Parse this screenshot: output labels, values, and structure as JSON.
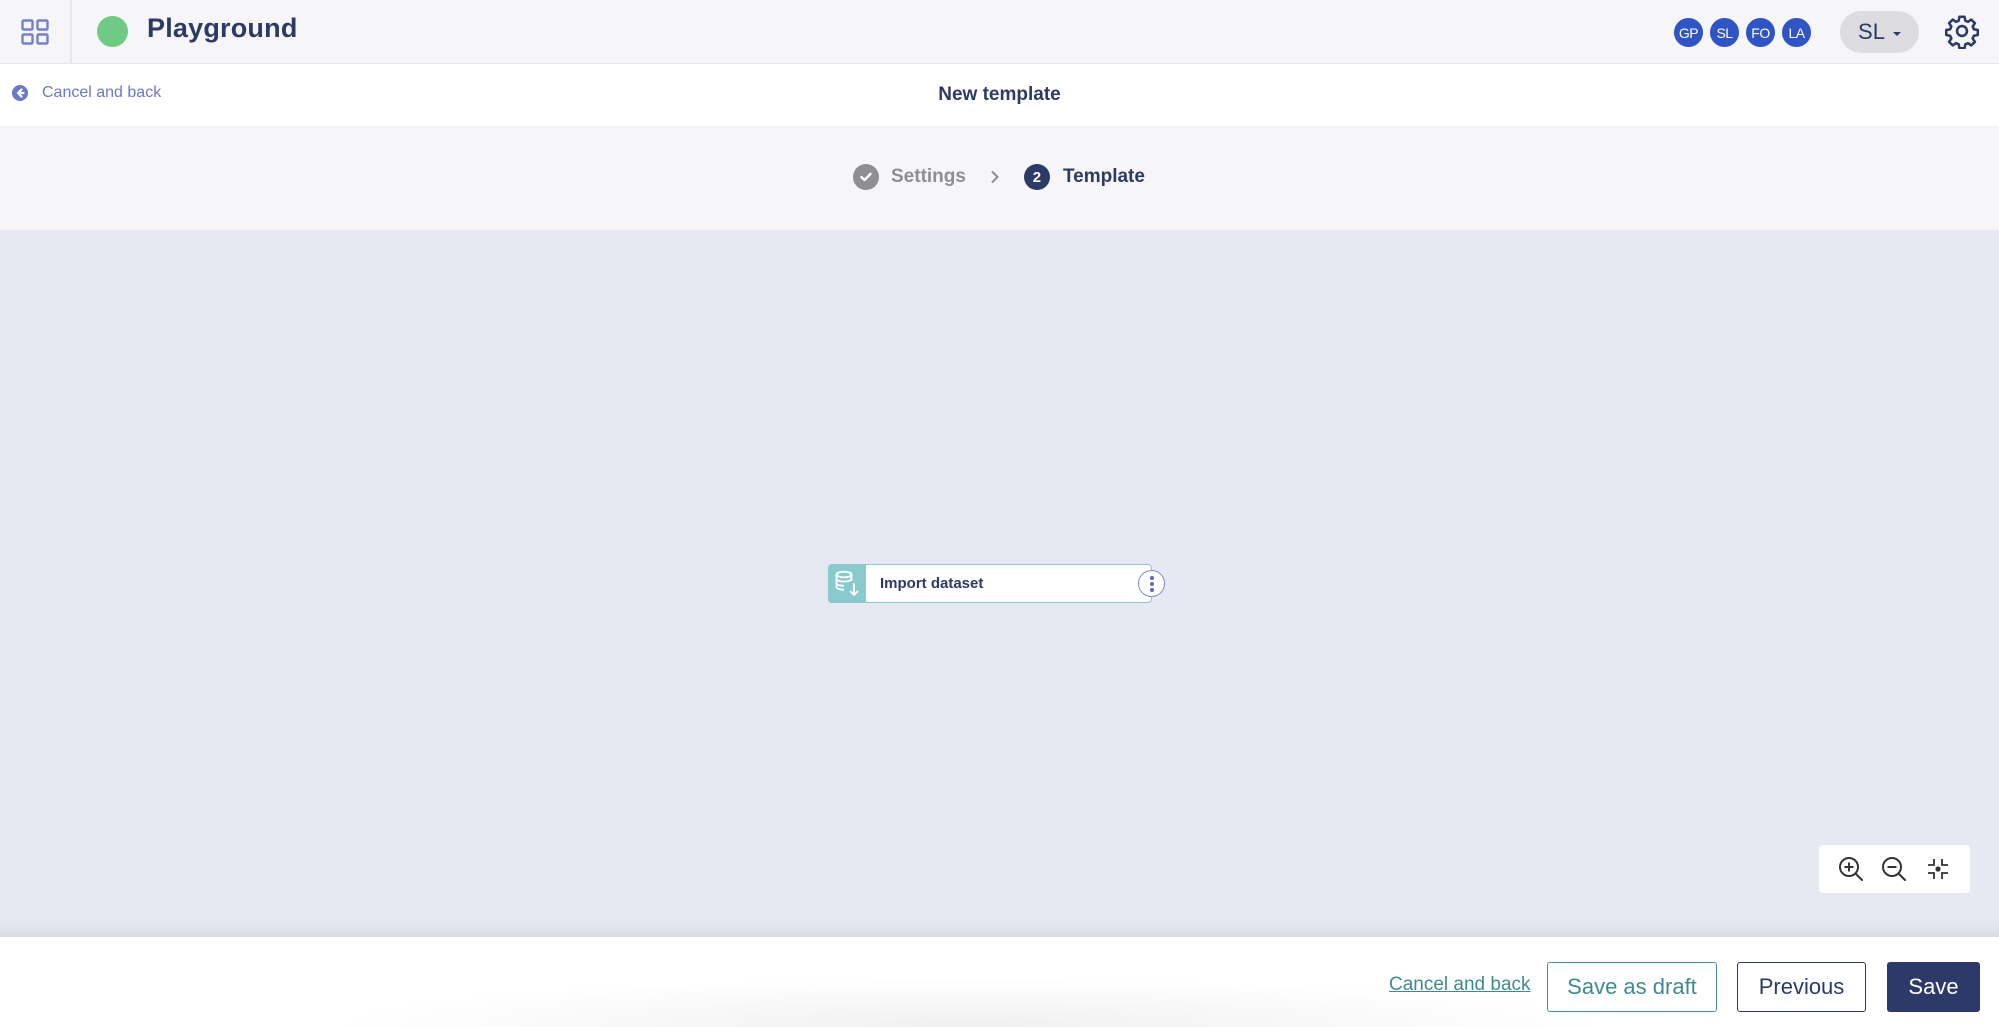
{
  "topbar": {
    "app_title": "Playground",
    "status_color": "#6fca83",
    "apps_icon": "grid-icon",
    "avatars": [
      "GP",
      "SL",
      "FO",
      "LA"
    ],
    "user_menu": {
      "initials": "SL",
      "icon": "caret-down-icon"
    },
    "settings_icon": "gear-icon"
  },
  "subheader": {
    "back_label": "Cancel and back",
    "back_icon": "arrow-left-circle-icon",
    "title": "New template"
  },
  "steps": [
    {
      "label": "Settings",
      "state": "done",
      "icon": "check-circle-icon"
    },
    {
      "number": "2",
      "label": "Template",
      "state": "active"
    }
  ],
  "canvas": {
    "nodes": [
      {
        "label": "Import dataset",
        "icon": "database-import-icon",
        "menu_icon": "more-vertical-icon"
      }
    ],
    "zoom_controls": [
      "zoom-in-icon",
      "zoom-out-icon",
      "fit-to-screen-icon"
    ]
  },
  "footer": {
    "cancel_label": "Cancel and back",
    "save_draft_label": "Save as draft",
    "previous_label": "Previous",
    "save_label": "Save"
  },
  "colors": {
    "primary": "#2c3a66",
    "accent": "#6c78c8",
    "teal": "#3d8a92",
    "avatar": "#2f55c4"
  }
}
